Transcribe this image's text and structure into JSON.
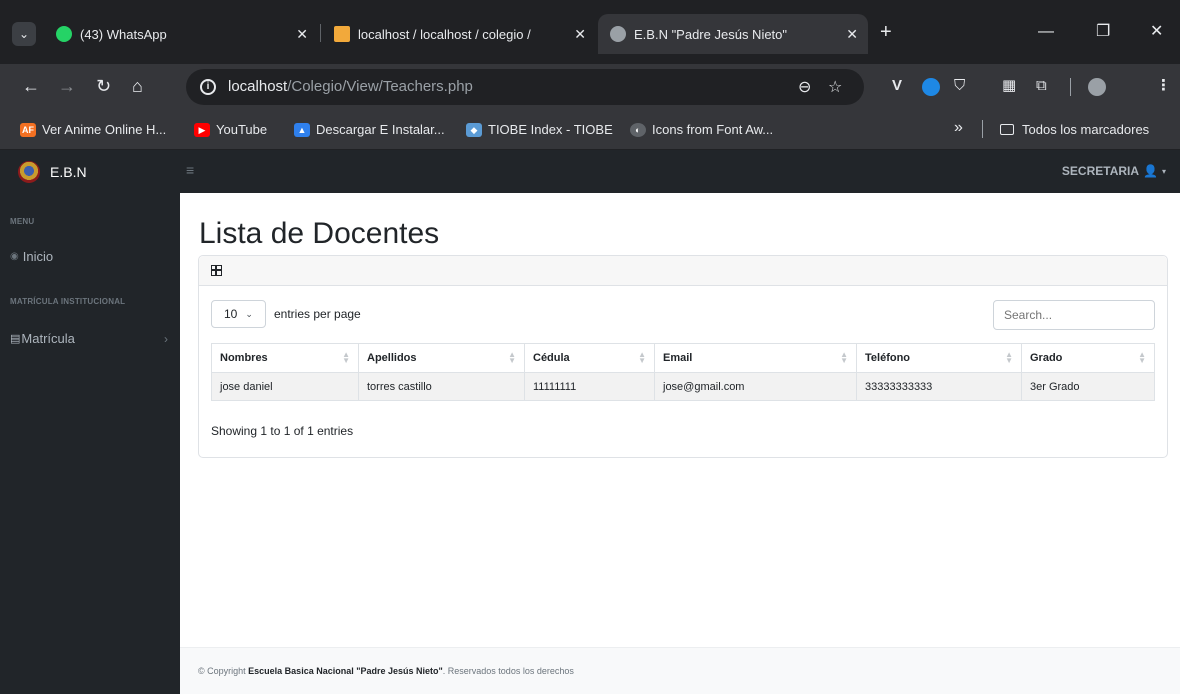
{
  "browser": {
    "tabs": [
      {
        "title": "(43) WhatsApp",
        "icon": "whatsapp-icon",
        "color": "#25d366"
      },
      {
        "title": "localhost / localhost / colegio / ",
        "icon": "phpmyadmin-icon",
        "color": "#f2a93b"
      },
      {
        "title": "E.B.N \"Padre Jesús Nieto\"",
        "icon": "globe-icon",
        "color": "#9aa0a6"
      }
    ],
    "url_host": "localhost",
    "url_path": "/Colegio/View/Teachers.php",
    "bookmarks": [
      {
        "label": "Ver Anime Online H...",
        "icon": "animeflv-icon",
        "badge": "AF",
        "color": "#f37022"
      },
      {
        "label": "YouTube",
        "icon": "youtube-icon",
        "badge": "▶",
        "color": "#ff0000"
      },
      {
        "label": "Descargar E Instalar...",
        "icon": "download-icon",
        "badge": "▲",
        "color": "#2f80ed"
      },
      {
        "label": "TIOBE Index - TIOBE",
        "icon": "tiobe-icon",
        "badge": "◆",
        "color": "#5b9bd5"
      },
      {
        "label": "Icons from Font Aw...",
        "icon": "globe-icon",
        "badge": "◐",
        "color": "#5f6368"
      }
    ],
    "bookmarks_folder": "Todos los marcadores",
    "more": "»"
  },
  "app": {
    "brand": "E.B.N",
    "user_label": "SECRETARIA",
    "sidebar": {
      "heading_menu": "MENU",
      "item_inicio": "Inicio",
      "heading_matricula": "MATRÍCULA INSTITUCIONAL",
      "item_matricula": "Matrícula"
    },
    "page_title": "Lista de Docentes",
    "table": {
      "page_size": "10",
      "entries_label": "entries per page",
      "search_placeholder": "Search...",
      "columns": [
        "Nombres",
        "Apellidos",
        "Cédula",
        "Email",
        "Teléfono",
        "Grado"
      ],
      "rows": [
        [
          "jose daniel",
          "torres castillo",
          "11111111",
          "jose@gmail.com",
          "33333333333",
          "3er Grado"
        ]
      ],
      "info": "Showing 1 to 1 of 1 entries"
    },
    "footer": {
      "prefix": "© Copyright ",
      "school": "Escuela Basica Nacional \"Padre Jesús Nieto\"",
      "suffix": ". Reservados todos los derechos"
    }
  }
}
